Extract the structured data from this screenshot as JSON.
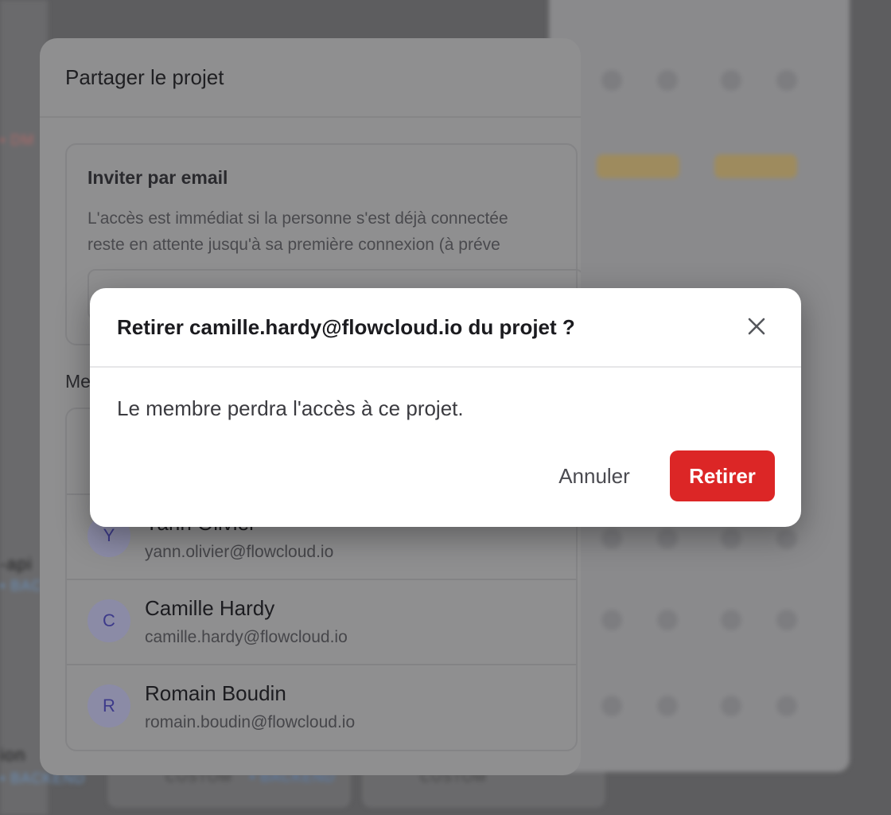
{
  "background": {
    "left_fragments": [
      "• DM",
      "-api",
      "• BAC",
      "ion",
      "• BACKEND"
    ],
    "bottom_tags": [
      "CUSTOM",
      "• BACKEND",
      "CUSTOM"
    ]
  },
  "share_modal": {
    "title": "Partager le projet",
    "invite": {
      "title": "Inviter par email",
      "description": "L'accès est immédiat si la personne s'est déjà connectée reste en attente jusqu'à sa première connexion (à préve"
    },
    "members_label": "Me",
    "members": [
      {
        "initial": "Y",
        "name": "Yann Olivier",
        "email": "yann.olivier@flowcloud.io"
      },
      {
        "initial": "C",
        "name": "Camille Hardy",
        "email": "camille.hardy@flowcloud.io"
      },
      {
        "initial": "R",
        "name": "Romain Boudin",
        "email": "romain.boudin@flowcloud.io"
      }
    ]
  },
  "confirm_dialog": {
    "title": "Retirer camille.hardy@flowcloud.io du projet ?",
    "message": "Le membre perdra l'accès à ce projet.",
    "cancel_label": "Annuler",
    "confirm_label": "Retirer",
    "close_icon": "close-icon",
    "confirm_color": "#dc2626"
  }
}
